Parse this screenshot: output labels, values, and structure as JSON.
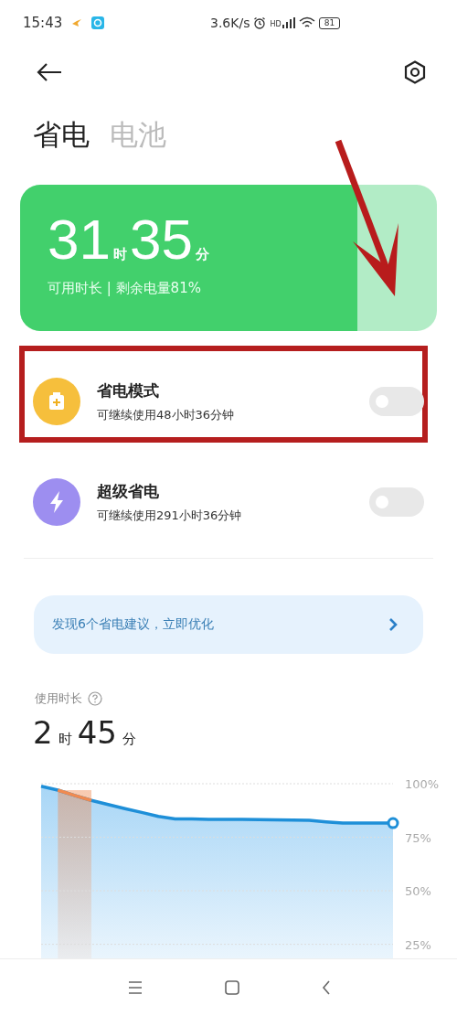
{
  "status_bar": {
    "time": "15:43",
    "speed": "3.6K/s",
    "network": "HD",
    "battery": "81"
  },
  "tabs": [
    {
      "label": "省电",
      "selected": true
    },
    {
      "label": "电池",
      "selected": false
    }
  ],
  "battery_card": {
    "hours": "31",
    "hours_unit": "时",
    "minutes": "35",
    "minutes_unit": "分",
    "caption": "可用时长 | 剩余电量81%",
    "level": 0.81
  },
  "modes": [
    {
      "title": "省电模式",
      "subtitle": "可继续使用48小时36分钟",
      "kind": "battery",
      "on": false,
      "color": "#f6bf3c",
      "highlighted": true
    },
    {
      "title": "超级省电",
      "subtitle": "可继续使用291小时36分钟",
      "kind": "bolt",
      "on": false,
      "color": "#9d8ef0",
      "highlighted": false
    }
  ],
  "suggestion": {
    "text": "发现6个省电建议，立即优化"
  },
  "usage": {
    "label": "使用时长",
    "hours": "2",
    "hours_unit": "时",
    "minutes": "45",
    "minutes_unit": "分",
    "charging_band": {
      "color": "#f08a50"
    },
    "chart_data": {
      "type": "line",
      "grid": true,
      "categories": [
        null,
        null,
        null,
        null,
        null,
        null,
        null,
        null,
        null,
        null,
        null,
        null,
        null,
        null,
        null,
        null,
        null,
        null,
        null,
        null,
        null,
        null
      ],
      "ylim": [
        18,
        100
      ],
      "yticks": [
        {
          "value": 100,
          "label": "100%"
        },
        {
          "value": 75,
          "label": "75%"
        },
        {
          "value": 50,
          "label": "50%"
        },
        {
          "value": 25,
          "label": "25%"
        }
      ],
      "series": [
        {
          "color": "#1e8fd8",
          "values": [
            98.8,
            97,
            94.5,
            92.2,
            90.3,
            88.4,
            86.6,
            84.7,
            83.6,
            83.5,
            83.4,
            83.3,
            83.3,
            83.2,
            83.1,
            83.0,
            82.9,
            82.2,
            81.6,
            81.6,
            81.6,
            81.6
          ]
        }
      ]
    }
  },
  "annotation_arrow": true
}
